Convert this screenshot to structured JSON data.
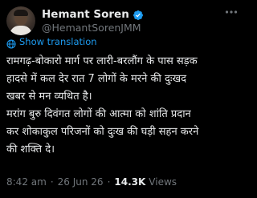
{
  "post": {
    "author": {
      "display_name": "Hemant Soren",
      "handle": "@HemantSorenJMM",
      "verified": true
    },
    "translate_label": "Show translation",
    "text_lines": [
      "रामगढ़-बोकारो मार्ग पर लारी-बरलौंग के पास सड़क",
      "हादसे में कल देर रात 7 लोगों के मरने की दुःखद",
      "खबर से मन व्यथित है।",
      "मरांग बुरु दिवंगत लोगों की आत्मा को शांति प्रदान",
      "कर शोकाकुल परिजनों को दुःख की घड़ी सहन करने",
      "की शक्ति दे।"
    ],
    "time": "8:42 am",
    "date": "26 Jun 26",
    "views_count": "14.3K",
    "views_label": "Views",
    "separator": "·"
  },
  "colors": {
    "background": "#000000",
    "text_primary": "#e7e9ea",
    "text_secondary": "#71767b",
    "accent": "#1d9bf0"
  },
  "icons": {
    "more": "more-horizontal-icon",
    "verified": "verified-badge-icon",
    "translate": "globe-icon"
  }
}
